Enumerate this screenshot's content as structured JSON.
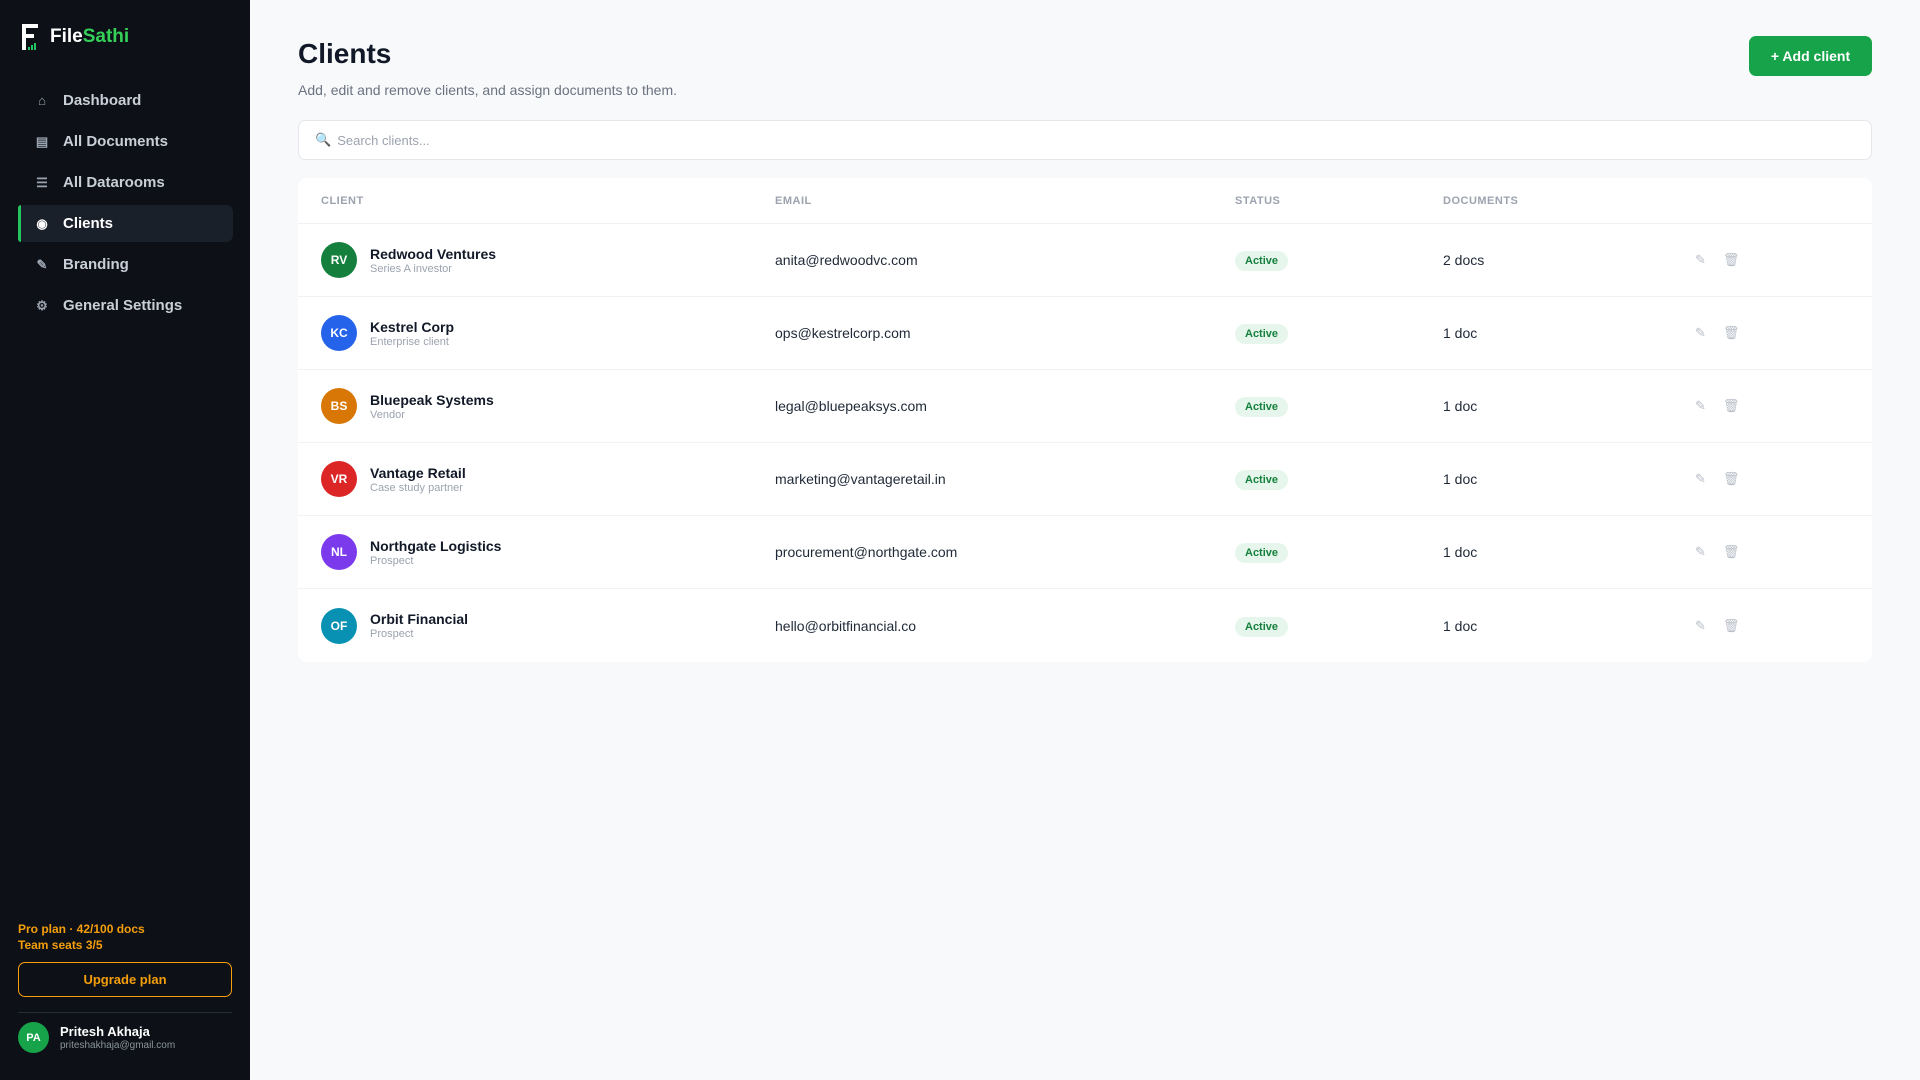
{
  "brand": {
    "prefix": "File",
    "suffix": "Sathi"
  },
  "nav": [
    {
      "label": "Dashboard",
      "icon": "home-icon",
      "glyph": "⌂"
    },
    {
      "label": "All Documents",
      "icon": "document-icon",
      "glyph": "▤"
    },
    {
      "label": "All Datarooms",
      "icon": "list-icon",
      "glyph": "☰"
    },
    {
      "label": "Clients",
      "icon": "clients-icon",
      "glyph": "◉"
    },
    {
      "label": "Branding",
      "icon": "brush-icon",
      "glyph": "✎"
    },
    {
      "label": "General Settings",
      "icon": "gear-icon",
      "glyph": "⚙"
    }
  ],
  "plan": {
    "line1": "Pro plan · 42/100 docs",
    "line2": "Team seats 3/5",
    "upgrade_label": "Upgrade plan"
  },
  "user": {
    "initials": "PA",
    "name": "Pritesh Akhaja",
    "email": "priteshakhaja@gmail.com"
  },
  "header": {
    "title": "Clients",
    "subtitle": "Add, edit and remove clients, and assign documents to them.",
    "add_label": "+ Add client"
  },
  "search": {
    "placeholder": "Search clients...",
    "value": ""
  },
  "table": {
    "headers": {
      "client": "CLIENT",
      "email": "EMAIL",
      "status": "STATUS",
      "documents": "DOCUMENTS"
    },
    "rows": [
      {
        "initials": "RV",
        "name": "Redwood Ventures",
        "desc": "Series A investor",
        "email": "anita@redwoodvc.com",
        "status": "Active",
        "docs": "2 docs",
        "color": "#15803d"
      },
      {
        "initials": "KC",
        "name": "Kestrel Corp",
        "desc": "Enterprise client",
        "email": "ops@kestrelcorp.com",
        "status": "Active",
        "docs": "1 doc",
        "color": "#2563eb"
      },
      {
        "initials": "BS",
        "name": "Bluepeak Systems",
        "desc": "Vendor",
        "email": "legal@bluepeaksys.com",
        "status": "Active",
        "docs": "1 doc",
        "color": "#d97706"
      },
      {
        "initials": "VR",
        "name": "Vantage Retail",
        "desc": "Case study partner",
        "email": "marketing@vantageretail.in",
        "status": "Active",
        "docs": "1 doc",
        "color": "#dc2626"
      },
      {
        "initials": "NL",
        "name": "Northgate Logistics",
        "desc": "Prospect",
        "email": "procurement@northgate.com",
        "status": "Active",
        "docs": "1 doc",
        "color": "#7c3aed"
      },
      {
        "initials": "OF",
        "name": "Orbit Financial",
        "desc": "Prospect",
        "email": "hello@orbitfinancial.co",
        "status": "Active",
        "docs": "1 doc",
        "color": "#0891b2"
      }
    ]
  },
  "colors": {
    "accent": "#16a34a",
    "sidebar_bg": "#0d1117",
    "warning": "#f59e0b"
  }
}
